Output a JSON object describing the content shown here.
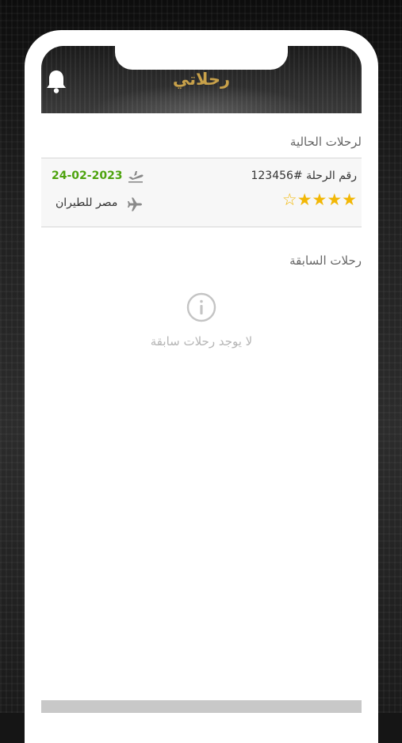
{
  "header": {
    "title": "رحلاتي",
    "bell_icon": "bell-icon"
  },
  "current_trips": {
    "section_title": "لرحلات الحالية",
    "trips": [
      {
        "trip_number": "رقم الرحلة #123456",
        "rating": 4,
        "rating_max": 5,
        "date": "24-02-2023",
        "airline": "مصر للطيران",
        "date_icon": "flight-departure-icon",
        "airline_icon": "airplane-icon"
      }
    ]
  },
  "previous_trips": {
    "section_title": "رحلات السابقة",
    "empty_icon": "info-icon",
    "empty_message": "لا يوجد رحلات سابقة"
  },
  "colors": {
    "title": "#c8a14a",
    "date": "#4ea30e",
    "stars": "#f2b705"
  }
}
